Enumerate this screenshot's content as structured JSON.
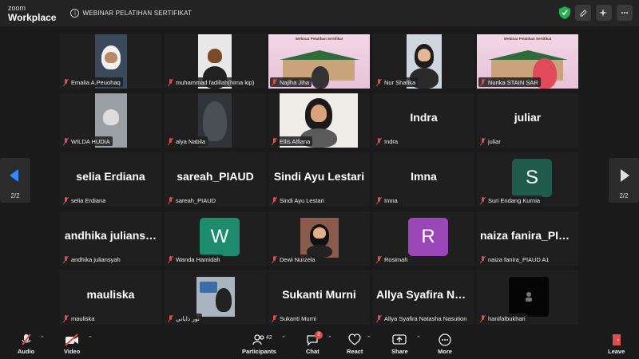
{
  "app": {
    "logo_top": "zoom",
    "logo_bottom": "Workplace",
    "meeting_title": "WEBINAR PELATIHAN SERTIFIKAT"
  },
  "nav": {
    "left_page": "2/2",
    "right_page": "2/2"
  },
  "banner": {
    "text": "Webinar Pelatihan Sertifikat"
  },
  "tiles": [
    {
      "name": "Emalia A.Peuohaq",
      "big": ""
    },
    {
      "name": "muhammad fadillah(hima kip)",
      "big": ""
    },
    {
      "name": "Najlha Jiha",
      "big": ""
    },
    {
      "name": "Nur Shafika",
      "big": ""
    },
    {
      "name": "Nurika STAIN SAR",
      "big": ""
    },
    {
      "name": "WILDA HUDIA",
      "big": ""
    },
    {
      "name": "alya Nabila",
      "big": ""
    },
    {
      "name": "Ellis Alfiana",
      "big": ""
    },
    {
      "name": "Indra",
      "big": "Indra"
    },
    {
      "name": "juliar",
      "big": "juliar"
    },
    {
      "name": "selia Erdiana",
      "big": "selia Erdiana"
    },
    {
      "name": "sareah_PIAUD",
      "big": "sareah_PIAUD"
    },
    {
      "name": "Sindi Ayu Lestari",
      "big": "Sindi Ayu Lestari"
    },
    {
      "name": "Imna",
      "big": "Imna"
    },
    {
      "name": "Suri Endang Kurnia",
      "big": "",
      "avatar": "S",
      "avatar_color": "#1e5b4a"
    },
    {
      "name": "andhika juliansyah",
      "big": "andhika julians…"
    },
    {
      "name": "Wanda Hamidah",
      "big": "",
      "avatar": "W",
      "avatar_color": "#1c8c6c"
    },
    {
      "name": "Dewi Nurzela",
      "big": ""
    },
    {
      "name": "Rosimah",
      "big": "",
      "avatar": "R",
      "avatar_color": "#9a46b8"
    },
    {
      "name": "naiza fanira_PIAUD A1",
      "big": "naiza fanira_PIA…"
    },
    {
      "name": "mauliska",
      "big": "mauliska"
    },
    {
      "name": "نور داياني",
      "big": ""
    },
    {
      "name": "Sukanti Murni",
      "big": "Sukanti Murni"
    },
    {
      "name": "Allya Syafira Natasha Nasution",
      "big": "Allya Syafira Na…"
    },
    {
      "name": "hanifalbukhari",
      "big": ""
    }
  ],
  "toolbar": {
    "audio": "Audio",
    "video": "Video",
    "participants": "Participants",
    "participants_count": "42",
    "chat": "Chat",
    "chat_badge": "2",
    "react": "React",
    "share": "Share",
    "more": "More",
    "leave": "Leave"
  },
  "colors": {
    "accent": "#2d8cff",
    "mute": "#e24b4b",
    "leave": "#e24b4b",
    "secure": "#22b14c"
  }
}
